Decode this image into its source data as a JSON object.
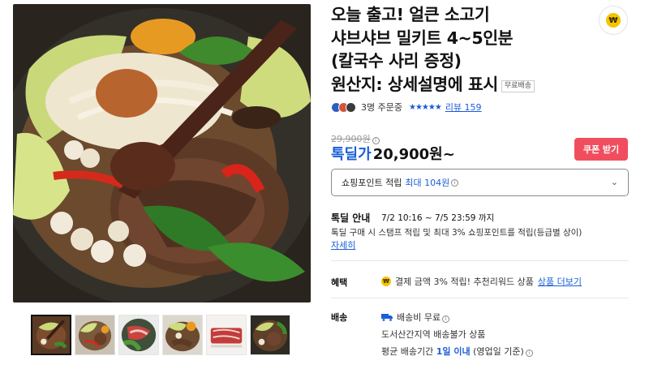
{
  "product": {
    "title_lines": [
      "오늘 출고! 얼큰 소고기",
      "샤브샤브 밀키트 4~5인분",
      "(칼국수 사리 증정)",
      "원산지: 상세설명에 표시"
    ],
    "free_shipping_badge": "무료배송",
    "pay_icon": "won-coin-icon"
  },
  "meta": {
    "buyers": "3명 주문중",
    "stars": "★★★★★",
    "rating": 5,
    "review_label": "리뷰 159"
  },
  "price": {
    "original": "29,900원",
    "original_info": "i",
    "deal_label": "톡딜가",
    "sale": "20,900원~",
    "coupon_label": "쿠폰 받기"
  },
  "points": {
    "label": "쇼핑포인트 적립",
    "max": "최대 104원",
    "info": "i"
  },
  "deal": {
    "heading": "톡딜 안내",
    "period": "7/2 10:16 ~ 7/5 23:59 까지",
    "description": "톡딜 구매 시 스탬프 적립 및 최대 3% 쇼핑포인트를 적립(등급별 상이)",
    "link": "자세히"
  },
  "benefit": {
    "label": "혜택",
    "text": "결제 금액 3% 적립! 추천리워드 상품",
    "link": "상품 더보기"
  },
  "shipping": {
    "label": "배송",
    "fee": "배송비 무료",
    "restriction": "도서산간지역 배송불가 상품",
    "avg_prefix": "평균 배송기간",
    "avg_value": "1일 이내",
    "avg_suffix": "(영업일 기준)"
  },
  "colors": {
    "accent_blue": "#1a5fd6",
    "coupon_red": "#f04e5e",
    "coin_yellow": "#f5c400"
  }
}
